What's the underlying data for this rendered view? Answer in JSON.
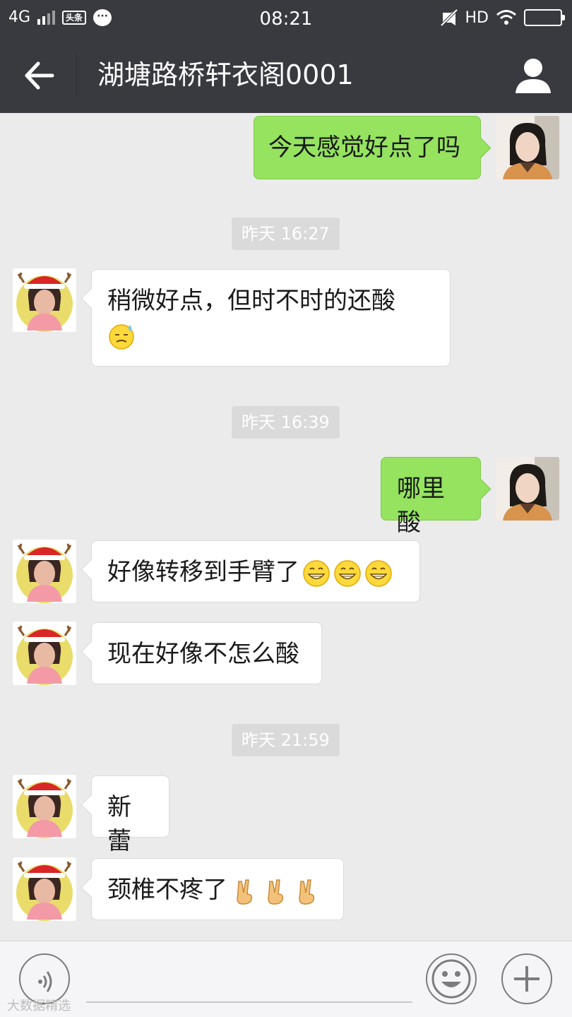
{
  "status_bar": {
    "network": "4G",
    "app_badge": "头条",
    "time": "08:21",
    "hd_label": "HD"
  },
  "header": {
    "title": "湖塘路桥轩衣阁0001",
    "back_icon": "arrow-left-icon",
    "profile_icon": "person-icon"
  },
  "messages": [
    {
      "sender": "me",
      "text": "今天感觉好点了吗"
    },
    {
      "timestamp": "昨天 16:27"
    },
    {
      "sender": "them",
      "text": "稍微好点，但时不时的还酸",
      "emoji": [
        "sweat-smile-emoji"
      ]
    },
    {
      "timestamp": "昨天 16:39"
    },
    {
      "sender": "me",
      "text": "哪里酸"
    },
    {
      "sender": "them",
      "text": "好像转移到手臂了",
      "emoji": [
        "grin-emoji",
        "grin-emoji",
        "grin-emoji"
      ]
    },
    {
      "sender": "them",
      "text": "现在好像不怎么酸"
    },
    {
      "timestamp": "昨天 21:59"
    },
    {
      "sender": "them",
      "text": "新蕾"
    },
    {
      "sender": "them",
      "text": "颈椎不疼了",
      "emoji": [
        "victory-hand-emoji",
        "victory-hand-emoji",
        "victory-hand-emoji"
      ]
    }
  ],
  "input_bar": {
    "voice_icon": "voice-icon",
    "emoji_icon": "smiley-icon",
    "plus_icon": "plus-icon"
  },
  "watermark": "大数据精选",
  "colors": {
    "header_bg": "#393a3f",
    "chat_bg": "#ebebeb",
    "my_bubble": "#95e35f",
    "their_bubble": "#ffffff",
    "timestamp_bg": "#dadada"
  }
}
